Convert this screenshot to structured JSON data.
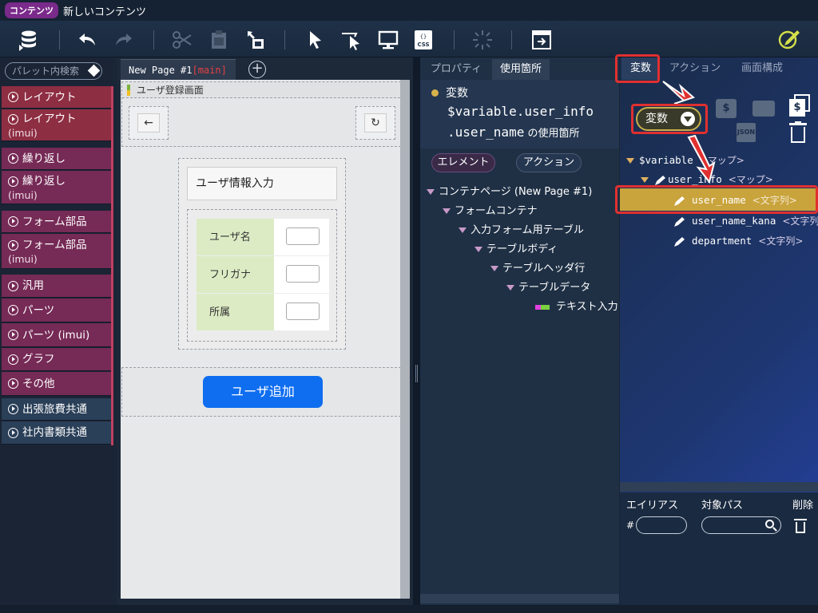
{
  "titlebar": {
    "badge": "コンテンツ",
    "title": "新しいコンテンツ"
  },
  "toolbar": {
    "icons": [
      "database-export-icon",
      "undo-icon",
      "redo-icon",
      "cut-icon",
      "paste-icon",
      "move-icon",
      "select-pointer-icon",
      "inspect-pointer-icon",
      "preview-monitor-icon",
      "css-icon",
      "loading-icon",
      "export-window-icon",
      "edit-check-icon"
    ]
  },
  "palette": {
    "search_placeholder": "パレット内検索",
    "items": [
      {
        "label": "レイアウト",
        "sub": ""
      },
      {
        "label": "レイアウト",
        "sub": "(imui)"
      },
      {
        "label": "繰り返し",
        "sub": ""
      },
      {
        "label": "繰り返し",
        "sub": "(imui)"
      },
      {
        "label": "フォーム部品",
        "sub": ""
      },
      {
        "label": "フォーム部品",
        "sub": "(imui)"
      },
      {
        "label": "汎用",
        "sub": ""
      },
      {
        "label": "パーツ",
        "sub": ""
      },
      {
        "label": "パーツ (imui)",
        "sub": ""
      },
      {
        "label": "グラフ",
        "sub": ""
      },
      {
        "label": "その他",
        "sub": ""
      },
      {
        "label": "出張旅費共通",
        "sub": ""
      },
      {
        "label": "社内書類共通",
        "sub": ""
      }
    ]
  },
  "canvas": {
    "tab_label": "New Page #1",
    "tab_main": "[main]",
    "header_title": "ユーザ登録画面",
    "form_title": "ユーザ情報入力",
    "rows": [
      {
        "label": "ユーザ名"
      },
      {
        "label": "フリガナ"
      },
      {
        "label": "所属"
      }
    ],
    "add_button": "ユーザ追加"
  },
  "props": {
    "tabs": [
      "プロパティ",
      "使用箇所"
    ],
    "var_label": "変数",
    "var_path1": "$variable.user_info",
    "var_path2": ".user_name",
    "usage_suffix": "の使用箇所",
    "filter_element": "エレメント",
    "filter_action": "アクション",
    "tree": [
      "コンテナページ (New Page #1)",
      "フォームコンテナ",
      "入力フォーム用テーブル",
      "テーブルボディ",
      "テーブルヘッダ行",
      "テーブルデータ",
      "テキスト入力"
    ]
  },
  "vars": {
    "tabs": [
      "変数",
      "アクション",
      "画面構成"
    ],
    "type_button": "変数",
    "nodes": [
      {
        "name": "$variable",
        "type": "<マップ>"
      },
      {
        "name": "user_info",
        "type": "<マップ>"
      },
      {
        "name": "user_name",
        "type": "<文字列>"
      },
      {
        "name": "user_name_kana",
        "type": "<文字列>"
      },
      {
        "name": "department",
        "type": "<文字列>"
      }
    ],
    "alias_header": "エイリアス",
    "target_header": "対象パス",
    "delete_header": "削除",
    "hash": "#"
  },
  "colors": {
    "accent_highlight": "#e03030",
    "selected_row": "#c9a33c",
    "primary_button": "#0f6ef0"
  }
}
